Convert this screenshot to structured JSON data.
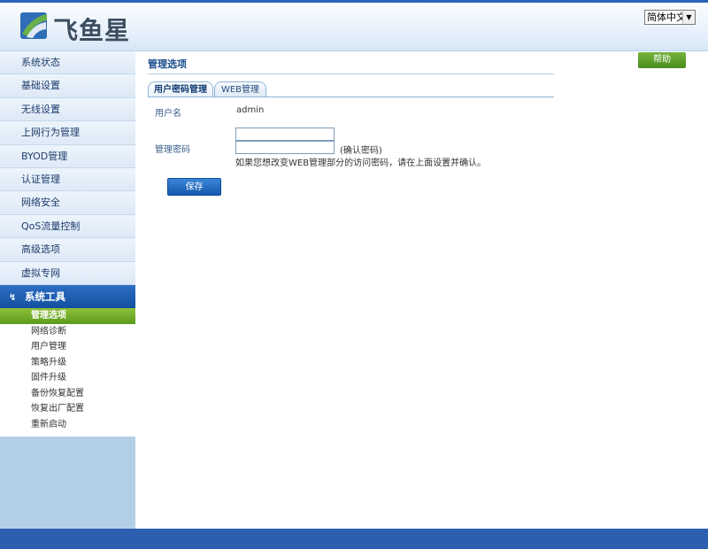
{
  "header": {
    "logo_text": "飞鱼星",
    "language_selected": "简体中文"
  },
  "sidebar": {
    "items": [
      {
        "label": "系统状态"
      },
      {
        "label": "基础设置"
      },
      {
        "label": "无线设置"
      },
      {
        "label": "上网行为管理"
      },
      {
        "label": "BYOD管理"
      },
      {
        "label": "认证管理"
      },
      {
        "label": "网络安全"
      },
      {
        "label": "QoS流量控制"
      },
      {
        "label": "高级选项"
      },
      {
        "label": "虚拟专网"
      }
    ],
    "section": {
      "label": "系统工具"
    },
    "subitems": [
      {
        "label": "管理选项",
        "active": true
      },
      {
        "label": "网络诊断"
      },
      {
        "label": "用户管理"
      },
      {
        "label": "策略升级"
      },
      {
        "label": "固件升级"
      },
      {
        "label": "备份恢复配置"
      },
      {
        "label": "恢复出厂配置"
      },
      {
        "label": "重新启动"
      }
    ]
  },
  "main": {
    "help_label": "帮助",
    "page_title": "管理选项",
    "tabs": [
      {
        "label": "用户密码管理",
        "active": true
      },
      {
        "label": "WEB管理"
      }
    ],
    "form": {
      "username_label": "用户名",
      "username_value": "admin",
      "password_label": "管理密码",
      "password_value": "",
      "confirm_value": "",
      "confirm_hint": "(确认密码)",
      "note": "如果您想改变WEB管理部分的访问密码，请在上面设置并确认。",
      "save_label": "保存"
    }
  },
  "colors": {
    "accent_blue": "#2c63b8",
    "active_green": "#5b9a1c",
    "sidebar_bg": "#b3cfe8"
  }
}
